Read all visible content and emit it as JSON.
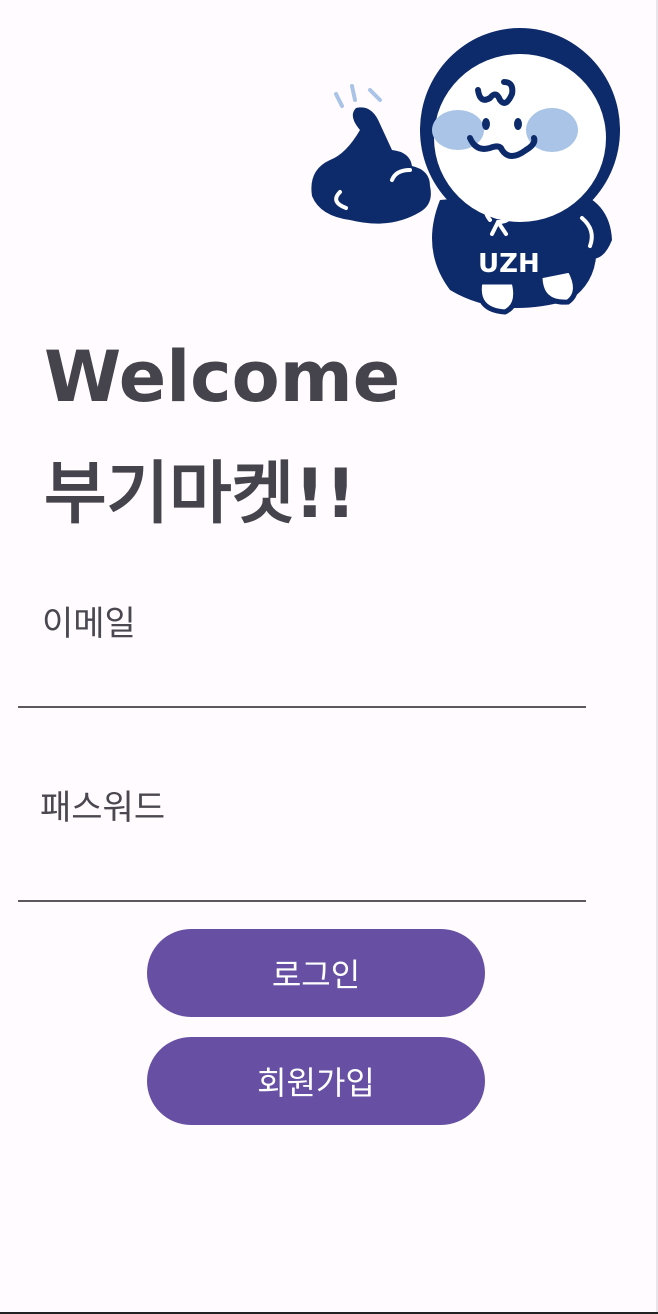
{
  "mascot": {
    "icon": "mascot-thumbs-up-icon",
    "shirt_text": "UZH",
    "colors": {
      "navy": "#0d2b6b",
      "cheek": "#a9c4e6",
      "face": "#ffffff"
    }
  },
  "header": {
    "welcome": "Welcome",
    "app_name": "부기마켓!!"
  },
  "form": {
    "email_label": "이메일",
    "password_label": "패스워드"
  },
  "buttons": {
    "login_label": "로그인",
    "signup_label": "회원가입"
  },
  "colors": {
    "background": "#fffbfe",
    "primary": "#6750a4",
    "title_text": "#45434b",
    "divider": "#5c5860"
  }
}
